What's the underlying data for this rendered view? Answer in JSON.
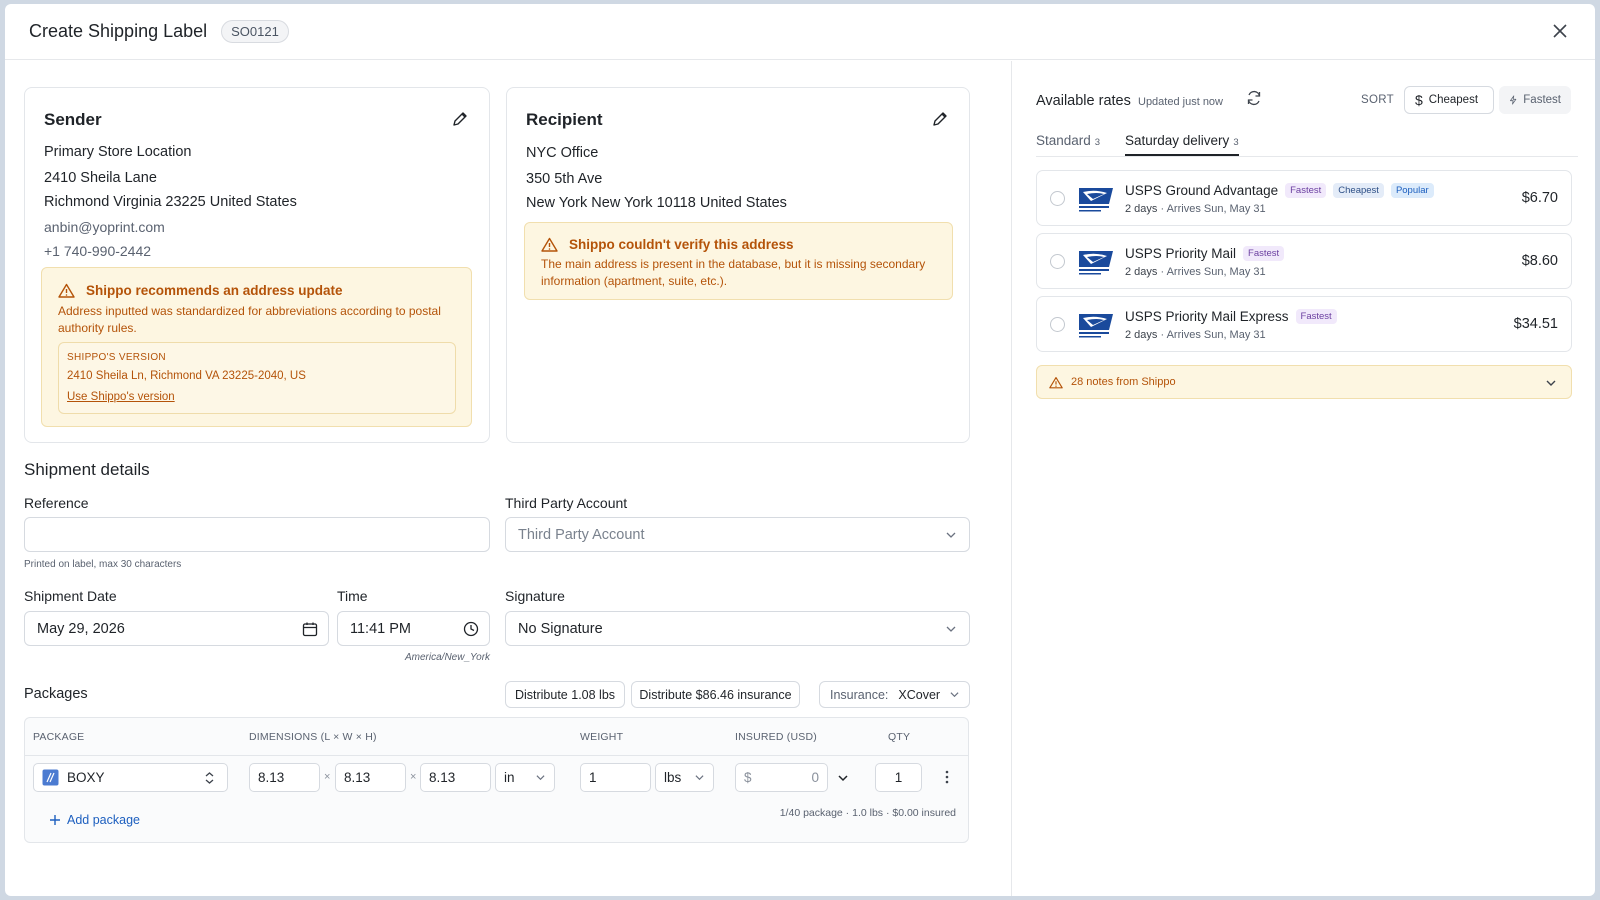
{
  "header": {
    "title": "Create Shipping Label",
    "order_id": "SO0121"
  },
  "sender": {
    "heading": "Sender",
    "lines": [
      "Primary Store Location",
      "2410 Sheila Lane",
      "Richmond Virginia 23225 United States"
    ],
    "email": "anbin@yoprint.com",
    "phone": "+1 740-990-2442",
    "warning": {
      "title": "Shippo recommends an address update",
      "desc_line1": "Address inputted was standardized for abbreviations according to postal",
      "desc_line2": "authority rules.",
      "version_label": "SHIPPO'S VERSION",
      "version_value": "2410 Sheila Ln, Richmond VA 23225-2040, US",
      "use_link": "Use Shippo's version"
    }
  },
  "recipient": {
    "heading": "Recipient",
    "lines": [
      "NYC Office",
      "350 5th Ave",
      "New York New York 10118 United States"
    ],
    "warning": {
      "title": "Shippo couldn't verify this address",
      "desc_line1": "The main address is present in the database, but it is missing secondary",
      "desc_line2": "information (apartment, suite, etc.)."
    }
  },
  "shipment": {
    "title": "Shipment details",
    "reference_label": "Reference",
    "reference_value": "",
    "reference_hint": "Printed on label, max 30 characters",
    "third_party_label": "Third Party Account",
    "third_party_placeholder": "Third Party Account",
    "date_label": "Shipment Date",
    "date_value": "May 29, 2026",
    "time_label": "Time",
    "time_value": "11:41 PM",
    "timezone": "America/New_York",
    "signature_label": "Signature",
    "signature_value": "No Signature"
  },
  "packages": {
    "title": "Packages",
    "distribute_weight": "Distribute 1.08 lbs",
    "distribute_insurance": "Distribute $86.46 insurance",
    "insurance_label": "Insurance:",
    "insurance_value": "XCover",
    "columns": [
      "PACKAGE",
      "DIMENSIONS (L × W × H)",
      "WEIGHT",
      "INSURED (USD)",
      "QTY"
    ],
    "row": {
      "package": "BOXY",
      "length": "8.13",
      "width": "8.13",
      "height": "8.13",
      "dim_unit": "in",
      "weight": "1",
      "weight_unit": "lbs",
      "currency": "$",
      "insured": "0",
      "qty": "1",
      "times": "×"
    },
    "add_label": "Add package",
    "summary": "1/40 package · 1.0 lbs · $0.00 insured"
  },
  "rates": {
    "title": "Available rates",
    "updated": "Updated just now",
    "sort_label": "SORT",
    "sort_cheapest": "Cheapest",
    "sort_fastest": "Fastest",
    "tabs": [
      {
        "label": "Standard",
        "count": "3"
      },
      {
        "label": "Saturday delivery",
        "count": "3"
      }
    ],
    "items": [
      {
        "name": "USPS Ground Advantage",
        "tags": [
          "Fastest",
          "Cheapest",
          "Popular"
        ],
        "days": "2 days",
        "arrives": "Arrives Sun, May 31",
        "price": "$6.70"
      },
      {
        "name": "USPS Priority Mail",
        "tags": [
          "Fastest"
        ],
        "days": "2 days",
        "arrives": "Arrives Sun, May 31",
        "price": "$8.60"
      },
      {
        "name": "USPS Priority Mail Express",
        "tags": [
          "Fastest"
        ],
        "days": "2 days",
        "arrives": "Arrives Sun, May 31",
        "price": "$34.51"
      }
    ],
    "notes": "28 notes from Shippo"
  },
  "colors": {
    "warning_text": "#b45309",
    "warning_bg": "#fdf6e1",
    "link_blue": "#1d5fbf",
    "usps_blue": "#1a4a9c"
  }
}
